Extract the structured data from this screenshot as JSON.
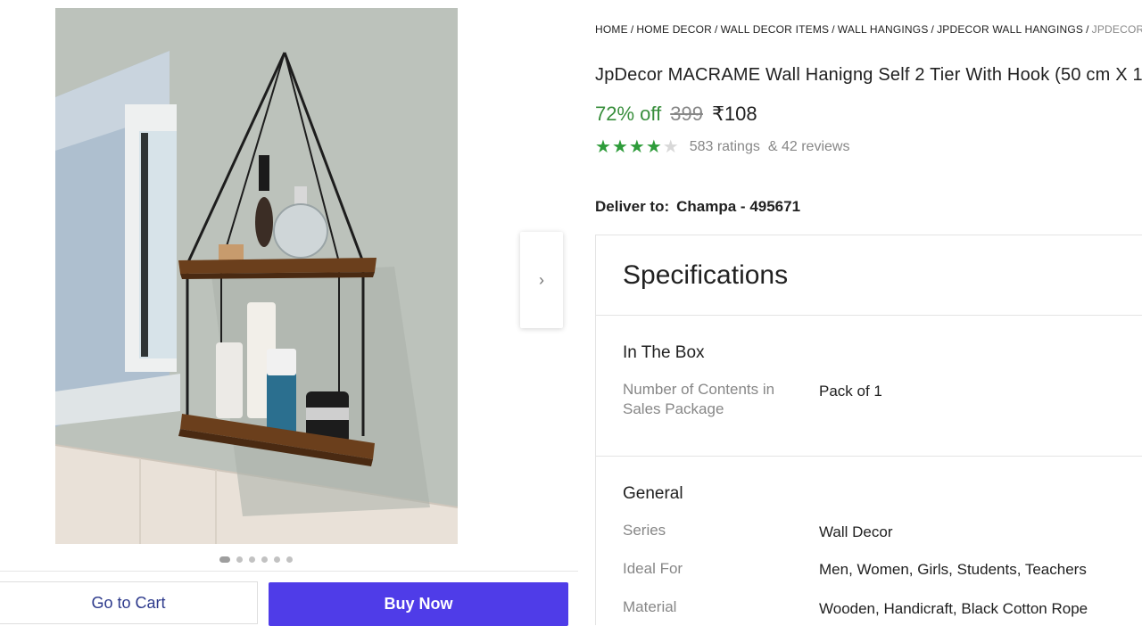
{
  "breadcrumb": [
    "HOME",
    "HOME DECOR",
    "WALL DECOR ITEMS",
    "WALL HANGINGS",
    "JPDECOR WALL HANGINGS",
    "JPDECOR"
  ],
  "product": {
    "title": "JpDecor MACRAME Wall Hanigng Self 2 Tier With Hook (50 cm X 1",
    "discount": "72% off",
    "mrp": "399",
    "price": "₹108",
    "rating_stars": 4,
    "ratings": "583 ratings",
    "reviews": "& 42 reviews"
  },
  "delivery": {
    "label": "Deliver to:",
    "location": "Champa - 495671"
  },
  "gallery": {
    "image_count": 6,
    "active_index": 0,
    "next_icon": "chevron-right-icon"
  },
  "actions": {
    "cart_label": "Go to Cart",
    "buy_label": "Buy Now"
  },
  "specifications": {
    "title": "Specifications",
    "groups": [
      {
        "name": "In The Box",
        "rows": [
          {
            "key": "Number of Contents in Sales Package",
            "value": "Pack of 1"
          }
        ]
      },
      {
        "name": "General",
        "rows": [
          {
            "key": "Series",
            "value": "Wall Decor"
          },
          {
            "key": "Ideal For",
            "value": "Men, Women, Girls, Students, Teachers"
          },
          {
            "key": "Material",
            "value": "Wooden, Handicraft, Black Cotton Rope"
          }
        ]
      }
    ]
  },
  "colors": {
    "discount": "#388e3c",
    "stars": "#2e9c3a",
    "buy_button": "#4f3ce8",
    "cart_text": "#2d3a8c"
  }
}
